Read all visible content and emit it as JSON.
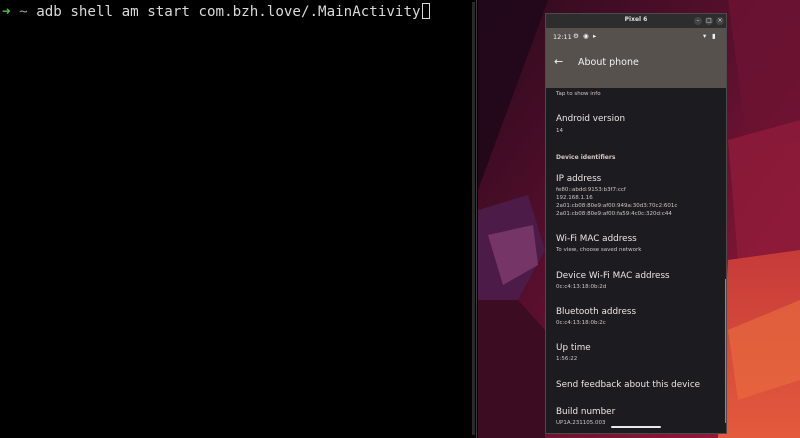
{
  "terminal": {
    "prompt_arrow": "➜",
    "cwd": "~",
    "command": "adb shell am start com.bzh.love/.MainActivity"
  },
  "emulator": {
    "window_title": "Pixel 6",
    "status_time": "12:11",
    "screen_title": "About phone",
    "top_partial_text": "Tap to show info",
    "items": [
      {
        "title": "Android version",
        "subtitle": "14"
      }
    ],
    "section_header": "Device identifiers",
    "ip_address": {
      "title": "IP address",
      "lines": [
        "fe80::abdd:9153:b3f7:ccf",
        "192.168.1.16",
        "2a01:cb08:80e9:af00:949a:30d3:70c2:601c",
        "2a01:cb08:80e9:af00:fa59:4c0c:320d:c44"
      ]
    },
    "wifi_mac": {
      "title": "Wi-Fi MAC address",
      "subtitle": "To view, choose saved network"
    },
    "device_wifi_mac": {
      "title": "Device Wi-Fi MAC address",
      "subtitle": "0c:c4:13:18:0b:2d"
    },
    "bluetooth": {
      "title": "Bluetooth address",
      "subtitle": "0c:c4:13:18:0b:2c"
    },
    "uptime": {
      "title": "Up time",
      "subtitle": "1:56:22"
    },
    "feedback": {
      "title": "Send feedback about this device"
    },
    "build": {
      "title": "Build number",
      "subtitle": "UP1A.231105.003"
    }
  }
}
